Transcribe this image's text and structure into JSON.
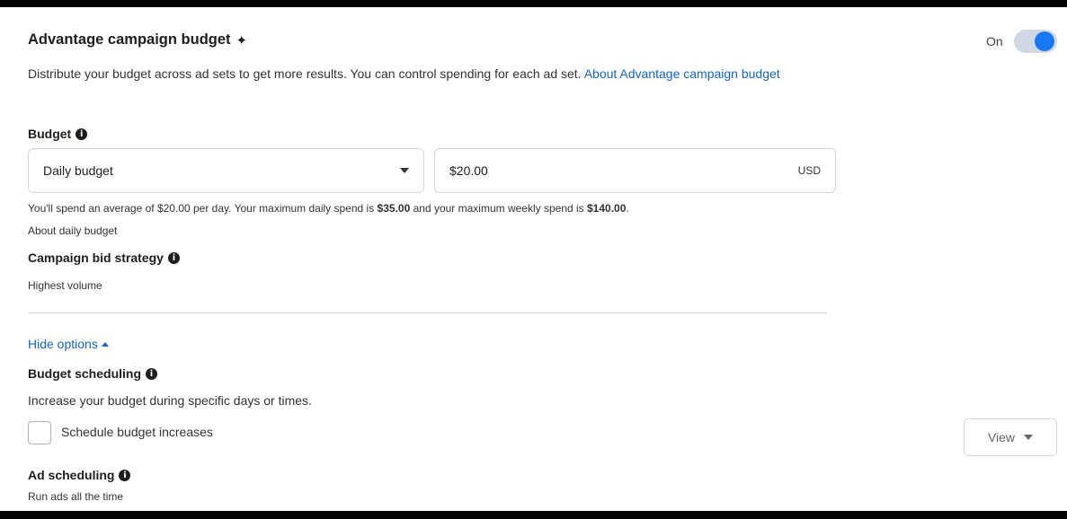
{
  "campaign_budget": {
    "title": "Advantage campaign budget",
    "sparkle": "✦",
    "toggle_label": "On",
    "toggle_on": true,
    "description": "Distribute your budget across ad sets to get more results. You can control spending for each ad set.",
    "about_link": "About Advantage campaign budget"
  },
  "budget": {
    "heading": "Budget",
    "type_select": "Daily budget",
    "amount": "$20.00",
    "currency": "USD",
    "summary_part1": "You'll spend an average of $20.00 per day. Your maximum daily spend is ",
    "max_daily": "$35.00",
    "summary_part2": " and your maximum weekly spend is ",
    "max_weekly": "$140.00",
    "summary_end": ".",
    "about_link": "About daily budget"
  },
  "bid_strategy": {
    "heading": "Campaign bid strategy",
    "value": "Highest volume"
  },
  "hide_options": "Hide options",
  "budget_scheduling": {
    "heading": "Budget scheduling",
    "description": "Increase your budget during specific days or times.",
    "checkbox_label": "Schedule budget increases",
    "checked": false,
    "view_button": "View"
  },
  "ad_scheduling": {
    "heading": "Ad scheduling",
    "value": "Run ads all the time"
  },
  "colors": {
    "link": "#1664c8",
    "toggle_accent": "#1877f2"
  }
}
